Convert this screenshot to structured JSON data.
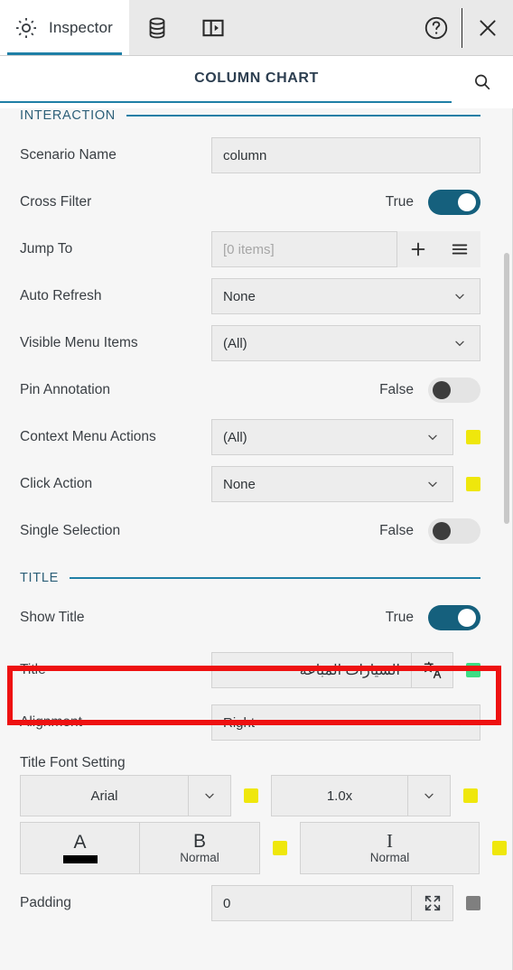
{
  "tabbar": {
    "tabs": [
      {
        "label": "Inspector",
        "icon": "gear-icon",
        "active": true
      },
      {
        "label": "",
        "icon": "database-icon",
        "active": false
      },
      {
        "label": "",
        "icon": "panel-toggle-icon",
        "active": false
      }
    ],
    "help_icon": "help-circle-icon",
    "close_icon": "close-icon"
  },
  "header": {
    "title": "COLUMN CHART",
    "search_icon": "search-icon",
    "accent_color": "#1f7fa6"
  },
  "groups": {
    "interaction": {
      "label": "INTERACTION"
    },
    "title": {
      "label": "TITLE"
    }
  },
  "interaction": {
    "scenario_name": {
      "label": "Scenario Name",
      "value": "column"
    },
    "cross_filter": {
      "label": "Cross Filter",
      "value": "True",
      "on": true
    },
    "jump_to": {
      "label": "Jump To",
      "placeholder": "[0 items]",
      "add_icon": "plus-icon",
      "menu_icon": "hamburger-menu-icon"
    },
    "auto_refresh": {
      "label": "Auto Refresh",
      "value": "None"
    },
    "visible_menu_items": {
      "label": "Visible Menu Items",
      "value": "(All)"
    },
    "pin_annotation": {
      "label": "Pin Annotation",
      "value": "False",
      "on": false
    },
    "context_menu_actions": {
      "label": "Context Menu Actions",
      "value": "(All)",
      "swatch": "#efe70c"
    },
    "click_action": {
      "label": "Click Action",
      "value": "None",
      "swatch": "#efe70c"
    },
    "single_selection": {
      "label": "Single Selection",
      "value": "False",
      "on": false
    }
  },
  "title_section": {
    "show_title": {
      "label": "Show Title",
      "value": "True",
      "on": true
    },
    "title": {
      "label": "Title",
      "value": "السيارات المباعة",
      "translate_icon": "translate-icon",
      "swatch": "#3ddc84",
      "highlighted": true
    },
    "alignment": {
      "label": "Alignment",
      "value": "Right"
    },
    "font_setting": {
      "label": "Title Font Setting",
      "family": "Arial",
      "family_swatch": "#efe70c",
      "size": "1.0x",
      "size_swatch": "#efe70c",
      "color_glyph": "A",
      "color_value": "#000000",
      "bold_glyph": "B",
      "bold_value": "Normal",
      "bold_swatch": "#efe70c",
      "italic_glyph": "I",
      "italic_value": "Normal",
      "italic_swatch": "#efe70c"
    },
    "padding": {
      "label": "Padding",
      "value": "0",
      "expand_icon": "expand-icon",
      "swatch": "#7f7f7f"
    }
  }
}
